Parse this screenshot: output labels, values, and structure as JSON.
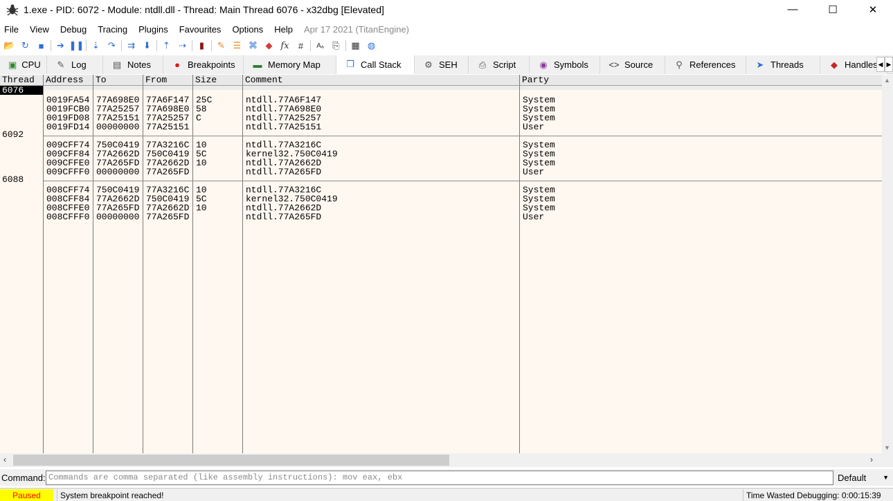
{
  "window": {
    "title": "1.exe - PID: 6072 - Module: ntdll.dll - Thread: Main Thread 6076 - x32dbg [Elevated]",
    "minimize": "—",
    "maximize": "☐",
    "close": "✕"
  },
  "menu": {
    "items": [
      "File",
      "View",
      "Debug",
      "Tracing",
      "Plugins",
      "Favourites",
      "Options",
      "Help"
    ],
    "date": "Apr 17 2021 (TitanEngine)"
  },
  "toolbar": {
    "buttons": [
      {
        "icon": "open-folder-icon",
        "glyph": "📂"
      },
      {
        "icon": "restart-icon",
        "glyph": "↻"
      },
      {
        "icon": "stop-icon",
        "glyph": "■"
      },
      {
        "icon": "run-icon",
        "glyph": "➔"
      },
      {
        "icon": "pause-icon",
        "glyph": "❚❚"
      },
      {
        "icon": "step-into-icon",
        "glyph": "⇣"
      },
      {
        "icon": "step-over-icon",
        "glyph": "↷"
      },
      {
        "icon": "trace-into-icon",
        "glyph": "⇉"
      },
      {
        "icon": "trace-over-icon",
        "glyph": "⬇"
      },
      {
        "icon": "execute-till-return-icon",
        "glyph": "⇡"
      },
      {
        "icon": "run-to-user-code-icon",
        "glyph": "⇢"
      },
      {
        "icon": "scylla-icon",
        "glyph": "▮"
      },
      {
        "icon": "comment-icon",
        "glyph": "✎"
      },
      {
        "icon": "label-icon",
        "glyph": "☰"
      },
      {
        "icon": "bookmark-icon",
        "glyph": "⌘"
      },
      {
        "icon": "breakpoint-tag-icon",
        "glyph": "◆"
      },
      {
        "icon": "function-icon",
        "glyph": "fx"
      },
      {
        "icon": "hash-icon",
        "glyph": "#"
      },
      {
        "icon": "font-size-icon",
        "glyph": "Aₐ"
      },
      {
        "icon": "patch-icon",
        "glyph": "⎘"
      },
      {
        "icon": "calculator-icon",
        "glyph": "▦"
      },
      {
        "icon": "globe-icon",
        "glyph": "◍"
      }
    ],
    "colors": {
      "blue": "#2f6fd6",
      "red": "#d63a3a",
      "orange": "#e28a2b"
    }
  },
  "tabs": [
    {
      "label": "CPU",
      "icon": "cpu-icon",
      "glyph": "▣",
      "color": "#2e8b2e"
    },
    {
      "label": "Log",
      "icon": "log-icon",
      "glyph": "✎",
      "color": "#555555"
    },
    {
      "label": "Notes",
      "icon": "notes-icon",
      "glyph": "▤",
      "color": "#555555"
    },
    {
      "label": "Breakpoints",
      "icon": "breakpoint-icon",
      "glyph": "●",
      "color": "#d81b1b"
    },
    {
      "label": "Memory Map",
      "icon": "memory-map-icon",
      "glyph": "▬",
      "color": "#2e7d32"
    },
    {
      "label": "Call Stack",
      "icon": "call-stack-icon",
      "glyph": "❐",
      "color": "#2f6fd6",
      "active": true
    },
    {
      "label": "SEH",
      "icon": "seh-icon",
      "glyph": "⚙",
      "color": "#555555"
    },
    {
      "label": "Script",
      "icon": "script-icon",
      "glyph": "⎙",
      "color": "#555555"
    },
    {
      "label": "Symbols",
      "icon": "symbols-icon",
      "glyph": "◉",
      "color": "#8e3a9d"
    },
    {
      "label": "Source",
      "icon": "source-icon",
      "glyph": "<>",
      "color": "#333333"
    },
    {
      "label": "References",
      "icon": "references-icon",
      "glyph": "⚲",
      "color": "#555555"
    },
    {
      "label": "Threads",
      "icon": "threads-icon",
      "glyph": "➤",
      "color": "#2f6fd6"
    },
    {
      "label": "Handles",
      "icon": "handles-icon",
      "glyph": "◆",
      "color": "#c62828"
    }
  ],
  "callstack": {
    "columns": [
      "Thread",
      "Address",
      "To",
      "From",
      "Size",
      "Comment",
      "Party"
    ],
    "threads": [
      {
        "id": "6076",
        "selected": true,
        "frames": [
          {
            "address": "0019FA54",
            "to": "77A698E0",
            "from": "77A6F147",
            "size": "25C",
            "comment": "ntdll.77A6F147",
            "party": "System"
          },
          {
            "address": "0019FCB0",
            "to": "77A25257",
            "from": "77A698E0",
            "size": "58",
            "comment": "ntdll.77A698E0",
            "party": "System"
          },
          {
            "address": "0019FD08",
            "to": "77A25151",
            "from": "77A25257",
            "size": "C",
            "comment": "ntdll.77A25257",
            "party": "System"
          },
          {
            "address": "0019FD14",
            "to": "00000000",
            "from": "77A25151",
            "size": "",
            "comment": "ntdll.77A25151",
            "party": "User"
          }
        ]
      },
      {
        "id": "6092",
        "selected": false,
        "frames": [
          {
            "address": "009CFF74",
            "to": "750C0419",
            "from": "77A3216C",
            "size": "10",
            "comment": "ntdll.77A3216C",
            "party": "System"
          },
          {
            "address": "009CFF84",
            "to": "77A2662D",
            "from": "750C0419",
            "size": "5C",
            "comment": "kernel32.750C0419",
            "party": "System"
          },
          {
            "address": "009CFFE0",
            "to": "77A265FD",
            "from": "77A2662D",
            "size": "10",
            "comment": "ntdll.77A2662D",
            "party": "System"
          },
          {
            "address": "009CFFF0",
            "to": "00000000",
            "from": "77A265FD",
            "size": "",
            "comment": "ntdll.77A265FD",
            "party": "User"
          }
        ]
      },
      {
        "id": "6088",
        "selected": false,
        "frames": [
          {
            "address": "008CFF74",
            "to": "750C0419",
            "from": "77A3216C",
            "size": "10",
            "comment": "ntdll.77A3216C",
            "party": "System"
          },
          {
            "address": "008CFF84",
            "to": "77A2662D",
            "from": "750C0419",
            "size": "5C",
            "comment": "kernel32.750C0419",
            "party": "System"
          },
          {
            "address": "008CFFE0",
            "to": "77A265FD",
            "from": "77A2662D",
            "size": "10",
            "comment": "ntdll.77A2662D",
            "party": "System"
          },
          {
            "address": "008CFFF0",
            "to": "00000000",
            "from": "77A265FD",
            "size": "",
            "comment": "ntdll.77A265FD",
            "party": "User"
          }
        ]
      }
    ]
  },
  "command": {
    "label": "Command:",
    "placeholder": "Commands are comma separated (like assembly instructions): mov eax, ebx",
    "mode": "Default"
  },
  "status": {
    "state": "Paused",
    "message": "System breakpoint reached!",
    "time_wasted": "Time Wasted Debugging: 0:00:15:39",
    "state_color": "#ffff00",
    "state_text_color": "#ff0000"
  }
}
